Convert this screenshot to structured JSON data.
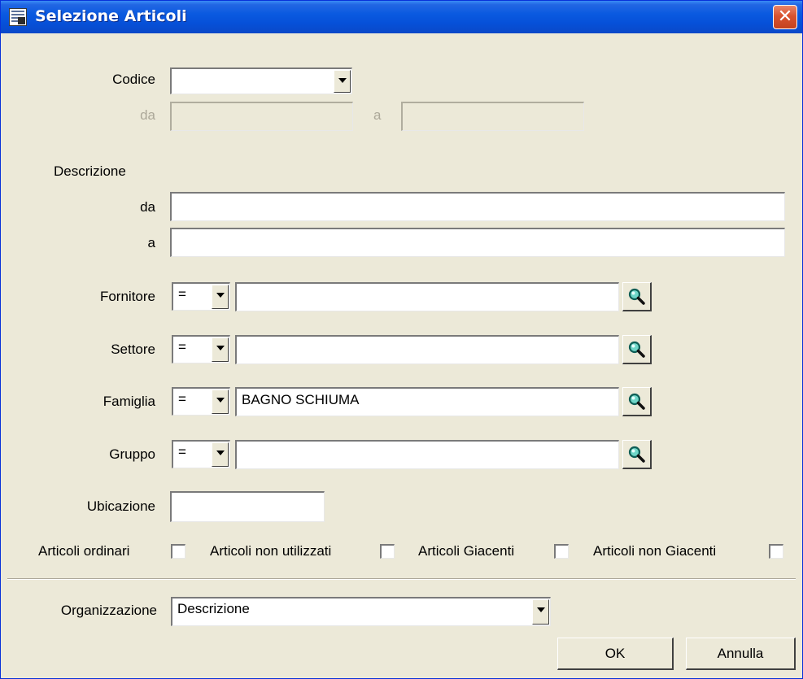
{
  "window": {
    "title": "Selezione Articoli",
    "close_glyph": "✕"
  },
  "codice": {
    "label": "Codice",
    "value": "",
    "da_label": "da",
    "a_label": "a",
    "da_value": "",
    "a_value": ""
  },
  "descrizione": {
    "label": "Descrizione",
    "da_label": "da",
    "a_label": "a",
    "da_value": "",
    "a_value": ""
  },
  "filters": [
    {
      "label": "Fornitore",
      "operator": "=",
      "value": ""
    },
    {
      "label": "Settore",
      "operator": "=",
      "value": ""
    },
    {
      "label": "Famiglia",
      "operator": "=",
      "value": "BAGNO SCHIUMA"
    },
    {
      "label": "Gruppo",
      "operator": "=",
      "value": ""
    }
  ],
  "ubicazione": {
    "label": "Ubicazione",
    "value": ""
  },
  "checkboxes": [
    {
      "label": "Articoli ordinari",
      "checked": false
    },
    {
      "label": "Articoli non utilizzati",
      "checked": false
    },
    {
      "label": "Articoli Giacenti",
      "checked": false
    },
    {
      "label": "Articoli non Giacenti",
      "checked": false
    }
  ],
  "organizzazione": {
    "label": "Organizzazione",
    "value": "Descrizione"
  },
  "buttons": {
    "ok": "OK",
    "cancel": "Annulla"
  },
  "icons": {
    "search": "magnifier-icon",
    "dropdown": "chevron-down-icon"
  },
  "colors": {
    "titlebar": "#0a5ae0",
    "window_bg": "#ece9d8",
    "close": "#d9532f",
    "search_lens": "#2fb4a8"
  }
}
